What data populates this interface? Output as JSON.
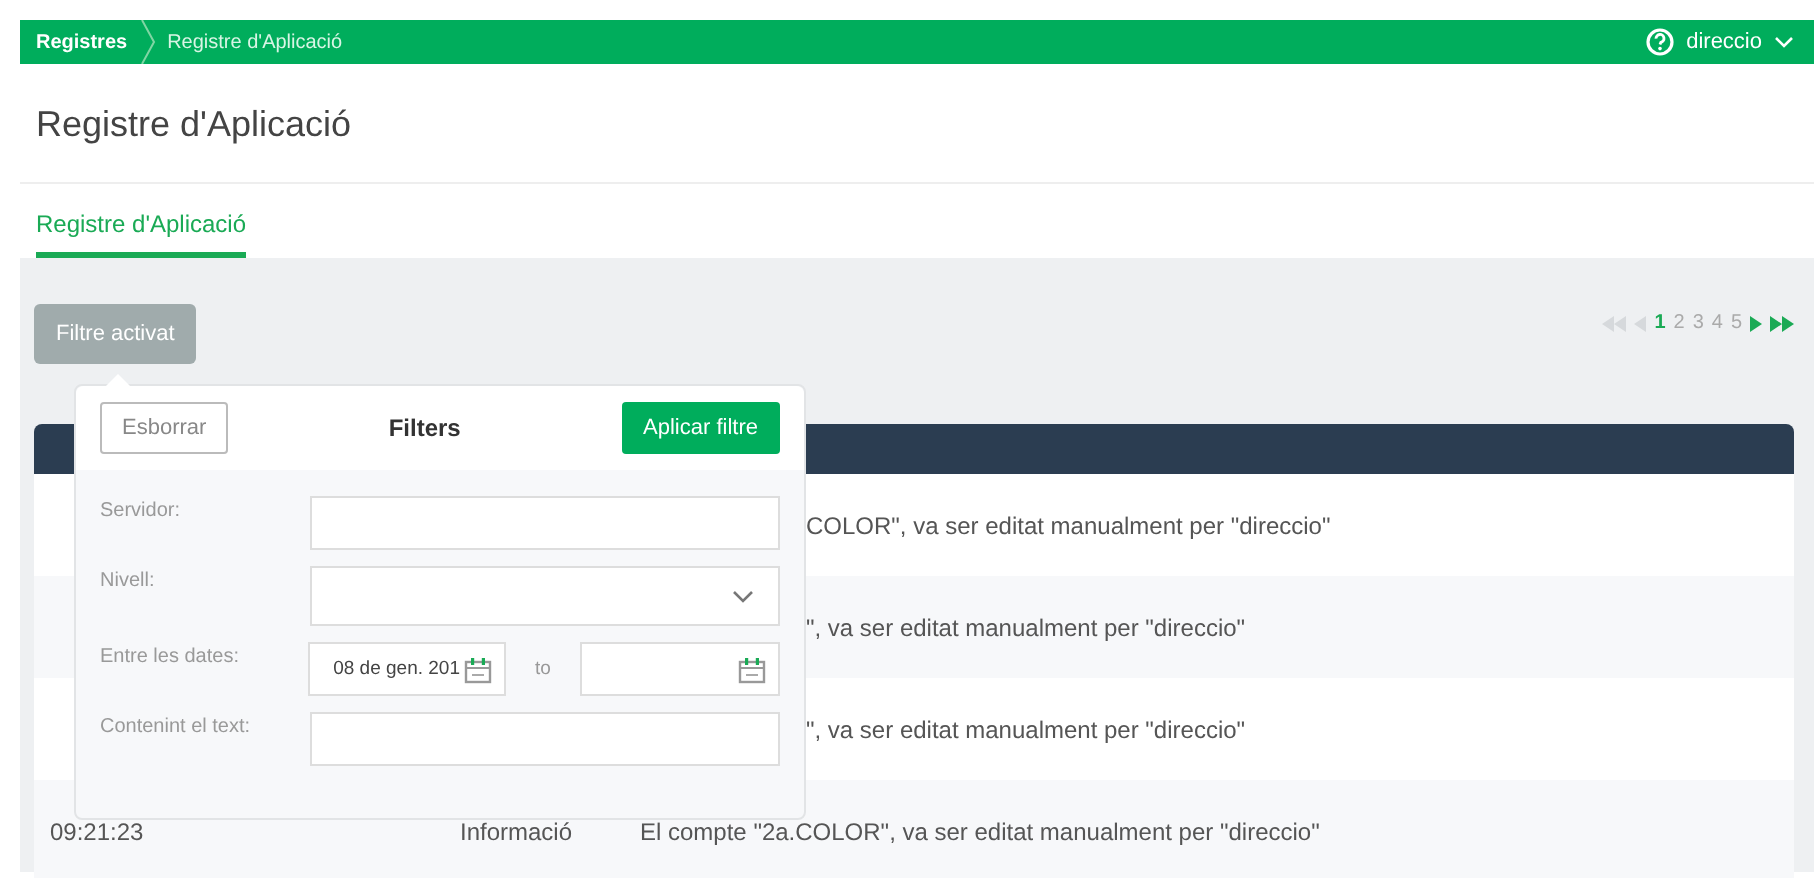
{
  "breadcrumb": [
    {
      "label": "Registres",
      "selected": false
    },
    {
      "label": "Registre d'Aplicació",
      "selected": true
    }
  ],
  "user": {
    "name": "direccio"
  },
  "page_title": "Registre d'Aplicació",
  "tabs": [
    {
      "label": "Registre d'Aplicació",
      "selected": true
    }
  ],
  "filter_button": "Filtre activat",
  "pagination": {
    "pages": [
      {
        "label": "1",
        "selected": true
      },
      {
        "label": "2",
        "selected": false
      },
      {
        "label": "3",
        "selected": false
      },
      {
        "label": "4",
        "selected": false
      },
      {
        "label": "5",
        "selected": false
      }
    ]
  },
  "table": {
    "rows": [
      {
        "kind": "partial",
        "message": "COLOR\", va ser editat manualment per \"direccio\""
      },
      {
        "kind": "partial",
        "message": "\", va ser editat manualment per \"direccio\""
      },
      {
        "kind": "partial",
        "message": "\", va ser editat manualment per \"direccio\""
      },
      {
        "kind": "full",
        "time": "09:21:23",
        "level": "Informació",
        "message": "El compte \"2a.COLOR\", va ser editat manualment per \"direccio\""
      }
    ]
  },
  "filters": {
    "title": "Filters",
    "clear_button": "Esborrar",
    "apply_button": "Aplicar filtre",
    "fields": [
      {
        "kind": "text",
        "label": "Servidor:"
      },
      {
        "kind": "select",
        "label": "Nivell:"
      },
      {
        "kind": "daterange",
        "label": "Entre les dates:",
        "from": "08 de gen. 201",
        "separator": "to"
      },
      {
        "kind": "text",
        "label": "Contenint el text:"
      }
    ]
  }
}
